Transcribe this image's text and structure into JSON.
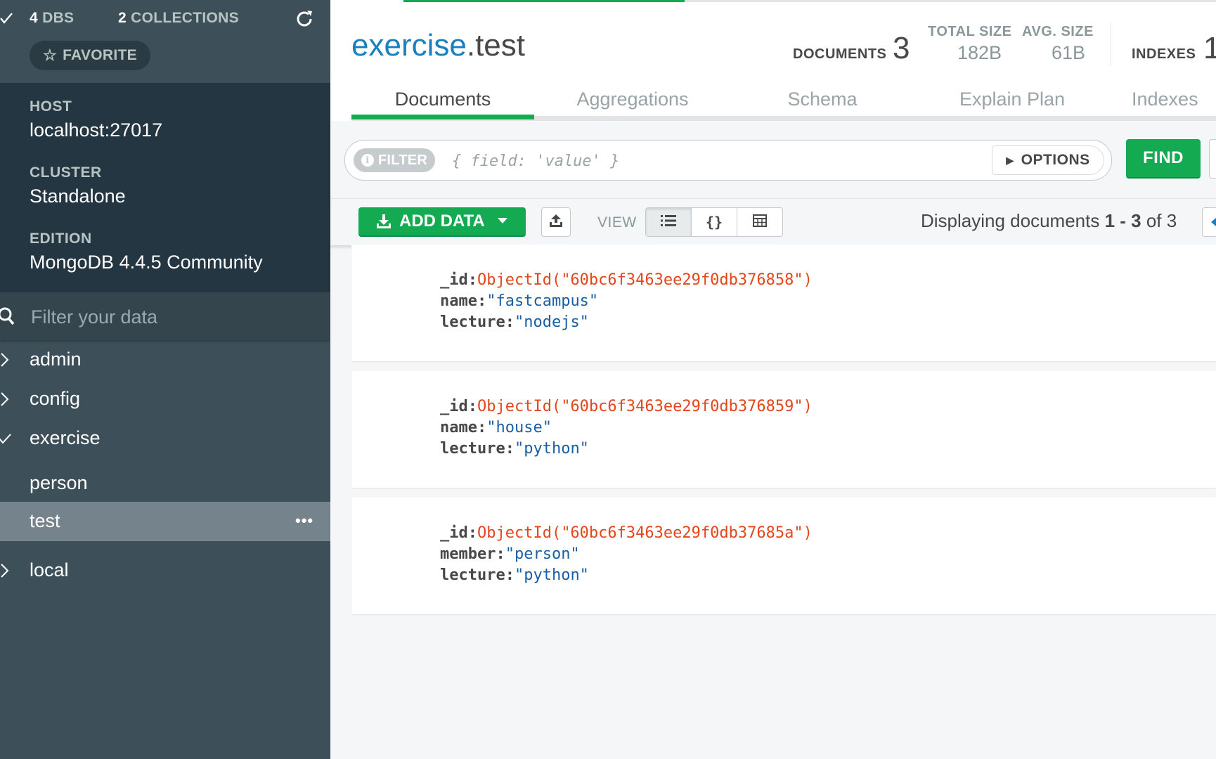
{
  "sidebar": {
    "stats": {
      "dbs_num": "4",
      "dbs_label": "DBS",
      "colls_num": "2",
      "colls_label": "COLLECTIONS"
    },
    "favorite_label": "FAVORITE",
    "info": [
      {
        "label": "HOST",
        "value": "localhost:27017"
      },
      {
        "label": "CLUSTER",
        "value": "Standalone"
      },
      {
        "label": "EDITION",
        "value": "MongoDB 4.4.5 Community"
      }
    ],
    "filter_placeholder": "Filter your data",
    "databases": [
      {
        "name": "admin"
      },
      {
        "name": "config"
      },
      {
        "name": "exercise",
        "collections": [
          {
            "name": "person"
          },
          {
            "name": "test"
          }
        ]
      },
      {
        "name": "local"
      }
    ],
    "more_label": "•••"
  },
  "header": {
    "db": "exercise",
    "collection": ".test",
    "documents_label": "DOCUMENTS",
    "documents_count": "3",
    "total_size_label": "TOTAL SIZE",
    "total_size": "182B",
    "avg_size_label": "AVG. SIZE",
    "avg_size": "61B",
    "indexes_label": "INDEXES",
    "indexes_count": "1",
    "tabs": [
      {
        "label": "Documents"
      },
      {
        "label": "Aggregations"
      },
      {
        "label": "Schema"
      },
      {
        "label": "Explain Plan"
      },
      {
        "label": "Indexes"
      }
    ]
  },
  "query": {
    "filter_label": "FILTER",
    "placeholder": "{ field: 'value' }",
    "options_label": "OPTIONS",
    "find_label": "FIND"
  },
  "toolbar": {
    "add_data_label": "ADD DATA",
    "view_label": "VIEW",
    "display_prefix": "Displaying documents ",
    "range_start": "1",
    "range_sep": " - ",
    "range_end": "3",
    "of_text": " of ",
    "total": "3"
  },
  "documents": [
    {
      "fields": [
        {
          "key": "_id:",
          "value": "ObjectId(\"60bc6f3463ee29f0db376858\")",
          "type": "oid"
        },
        {
          "key": "name:",
          "value": "\"fastcampus\"",
          "type": "str"
        },
        {
          "key": "lecture:",
          "value": "\"nodejs\"",
          "type": "str"
        }
      ]
    },
    {
      "fields": [
        {
          "key": "_id:",
          "value": "ObjectId(\"60bc6f3463ee29f0db376859\")",
          "type": "oid"
        },
        {
          "key": "name:",
          "value": "\"house\"",
          "type": "str"
        },
        {
          "key": "lecture:",
          "value": "\"python\"",
          "type": "str"
        }
      ]
    },
    {
      "fields": [
        {
          "key": "_id:",
          "value": "ObjectId(\"60bc6f3463ee29f0db37685a\")",
          "type": "oid"
        },
        {
          "key": "member:",
          "value": "\"person\"",
          "type": "str"
        },
        {
          "key": "lecture:",
          "value": "\"python\"",
          "type": "str"
        }
      ]
    }
  ],
  "colors": {
    "accent_green": "#13aa52",
    "sidebar_bg": "#3d4f58",
    "sidebar_info_bg": "#243641",
    "link_blue": "#1a7fbf",
    "oid_red": "#e3461b",
    "string_blue": "#1a5fa3"
  },
  "icons": [
    "check-icon",
    "refresh-icon",
    "star-icon",
    "search-icon",
    "chevron-right-icon",
    "more-icon",
    "info-icon",
    "caret-right-icon",
    "download-icon",
    "caret-down-icon",
    "upload-icon",
    "list-view-icon",
    "json-view-icon",
    "table-view-icon"
  ]
}
